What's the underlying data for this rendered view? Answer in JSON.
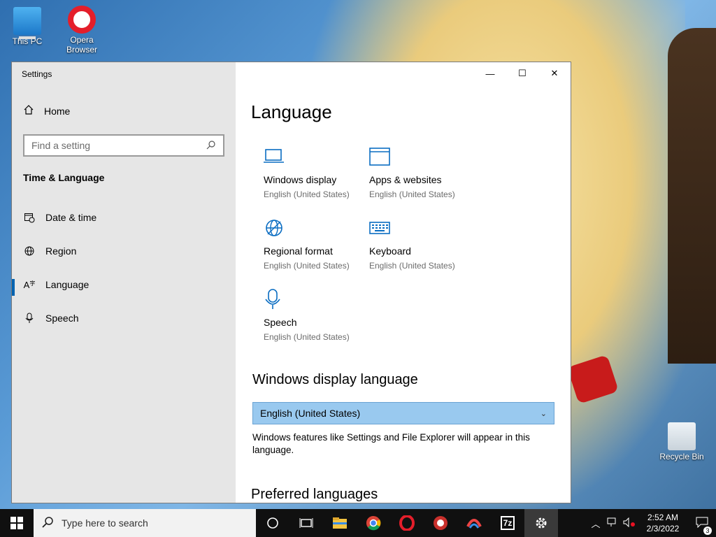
{
  "desktop": {
    "icons": [
      {
        "label": "This PC"
      },
      {
        "label": "Opera Browser"
      },
      {
        "label": "Recycle Bin"
      }
    ]
  },
  "window": {
    "title": "Settings",
    "caption": {
      "minimize": "—",
      "maximize": "☐",
      "close": "✕"
    }
  },
  "sidebar": {
    "home_label": "Home",
    "search_placeholder": "Find a setting",
    "section_title": "Time & Language",
    "items": [
      {
        "label": "Date & time",
        "icon": "calendar-clock-icon"
      },
      {
        "label": "Region",
        "icon": "globe-icon"
      },
      {
        "label": "Language",
        "icon": "language-icon",
        "active": true
      },
      {
        "label": "Speech",
        "icon": "microphone-icon"
      }
    ]
  },
  "main": {
    "title": "Language",
    "tiles": [
      {
        "name": "Windows display",
        "sub": "English (United States)",
        "icon": "monitor-icon"
      },
      {
        "name": "Apps & websites",
        "sub": "English (United States)",
        "icon": "browser-window-icon"
      },
      {
        "name": "Regional format",
        "sub": "English (United States)",
        "icon": "globe-icon"
      },
      {
        "name": "Keyboard",
        "sub": "English (United States)",
        "icon": "keyboard-icon"
      },
      {
        "name": "Speech",
        "sub": "English (United States)",
        "icon": "microphone-icon"
      }
    ],
    "display_language": {
      "heading": "Windows display language",
      "value": "English (United States)",
      "description": "Windows features like Settings and File Explorer will appear in this language."
    },
    "preferred_heading": "Preferred languages"
  },
  "taskbar": {
    "search_placeholder": "Type here to search",
    "apps": [
      "cortana-icon",
      "task-view-icon",
      "file-explorer-icon",
      "chrome-icon",
      "opera-icon",
      "ccleaner-icon",
      "ccleaner-browser-icon",
      "7zip-icon",
      "settings-icon"
    ],
    "app_7z_label": "7z",
    "clock_time": "2:52 AM",
    "clock_date": "2/3/2022",
    "notification_count": "3"
  },
  "colors": {
    "accent": "#0063b1",
    "tile_icon": "#0a6dc2",
    "dropdown_bg": "#99c9ef"
  }
}
